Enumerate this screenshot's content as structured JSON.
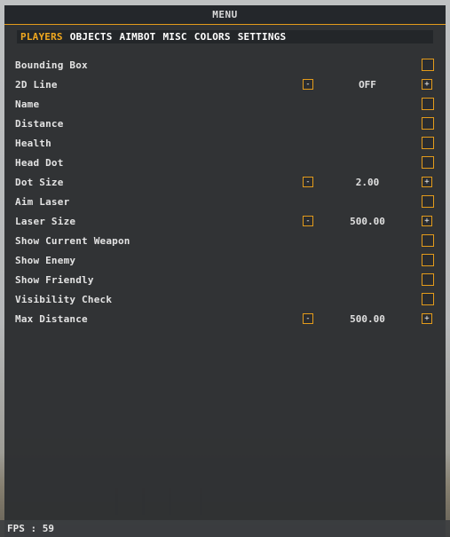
{
  "window": {
    "title": "MENU"
  },
  "tabs": [
    {
      "label": "PLAYERS",
      "active": true
    },
    {
      "label": "OBJECTS",
      "active": false
    },
    {
      "label": "AIMBOT",
      "active": false
    },
    {
      "label": "MISC",
      "active": false
    },
    {
      "label": "COLORS",
      "active": false
    },
    {
      "label": "SETTINGS",
      "active": false
    }
  ],
  "options": [
    {
      "label": "Bounding Box",
      "kind": "checkbox",
      "checked": false
    },
    {
      "label": "2D Line",
      "kind": "stepper",
      "value": "OFF",
      "minus": "-",
      "plus": "+"
    },
    {
      "label": "Name",
      "kind": "checkbox",
      "checked": false
    },
    {
      "label": "Distance",
      "kind": "checkbox",
      "checked": false
    },
    {
      "label": "Health",
      "kind": "checkbox",
      "checked": false
    },
    {
      "label": "Head Dot",
      "kind": "checkbox",
      "checked": false
    },
    {
      "label": "Dot Size",
      "kind": "stepper",
      "value": "2.00",
      "minus": "-",
      "plus": "+"
    },
    {
      "label": "Aim Laser",
      "kind": "checkbox",
      "checked": false
    },
    {
      "label": "Laser Size",
      "kind": "stepper",
      "value": "500.00",
      "minus": "-",
      "plus": "+"
    },
    {
      "label": "Show Current Weapon",
      "kind": "checkbox",
      "checked": false
    },
    {
      "label": "Show Enemy",
      "kind": "checkbox",
      "checked": false
    },
    {
      "label": "Show Friendly",
      "kind": "checkbox",
      "checked": false
    },
    {
      "label": "Visibility Check",
      "kind": "checkbox",
      "checked": false
    },
    {
      "label": "Max Distance",
      "kind": "stepper",
      "value": "500.00",
      "minus": "-",
      "plus": "+"
    }
  ],
  "status": {
    "fps": "FPS : 59"
  },
  "colors": {
    "accent": "#e39b1b",
    "active_tab": "#f0a81f",
    "panel": "#2f3133",
    "titlebar": "#24272b"
  }
}
